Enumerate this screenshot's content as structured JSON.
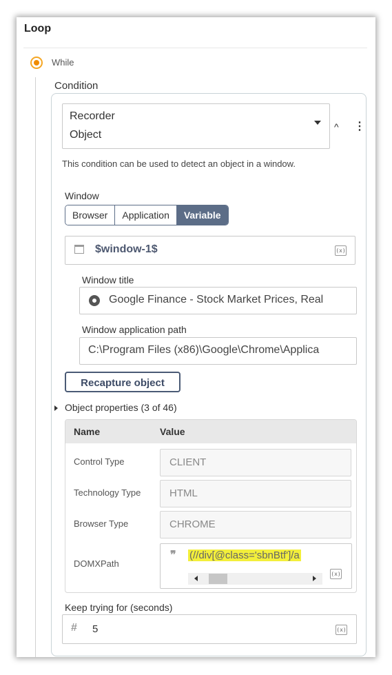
{
  "loop": {
    "title": "Loop",
    "while_label": "While",
    "condition_label": "Condition"
  },
  "condition": {
    "dropdown_line1": "Recorder",
    "dropdown_line2": "Object",
    "collapse_icon": "chevron-up-icon",
    "more_icon": "kebab-menu-icon",
    "description": "This condition can be used to detect an object in a window."
  },
  "window": {
    "label": "Window",
    "options": [
      "Browser",
      "Application",
      "Variable"
    ],
    "selected": "Variable",
    "variable_value": "$window-1$",
    "title_label": "Window title",
    "title_value": "Google Finance - Stock Market Prices, Real",
    "app_path_label": "Window application path",
    "app_path_value": "C:\\Program Files (x86)\\Google\\Chrome\\Applica"
  },
  "recapture_label": "Recapture object",
  "object_properties": {
    "label": "Object properties (3 of 46)",
    "col_name": "Name",
    "col_value": "Value",
    "rows": [
      {
        "name": "Control Type",
        "value": "CLIENT"
      },
      {
        "name": "Technology Type",
        "value": "HTML"
      },
      {
        "name": "Browser Type",
        "value": "CHROME"
      },
      {
        "name": "DOMXPath",
        "value": "(//div[@class='sbnBtf']/a"
      }
    ]
  },
  "keep_trying": {
    "label": "Keep trying for (seconds)",
    "value": "5"
  },
  "variable_button_text": "(x)",
  "colors": {
    "accent_orange": "#f08c00",
    "segment_active": "#5c6d87",
    "highlight": "#f3ef3b"
  }
}
